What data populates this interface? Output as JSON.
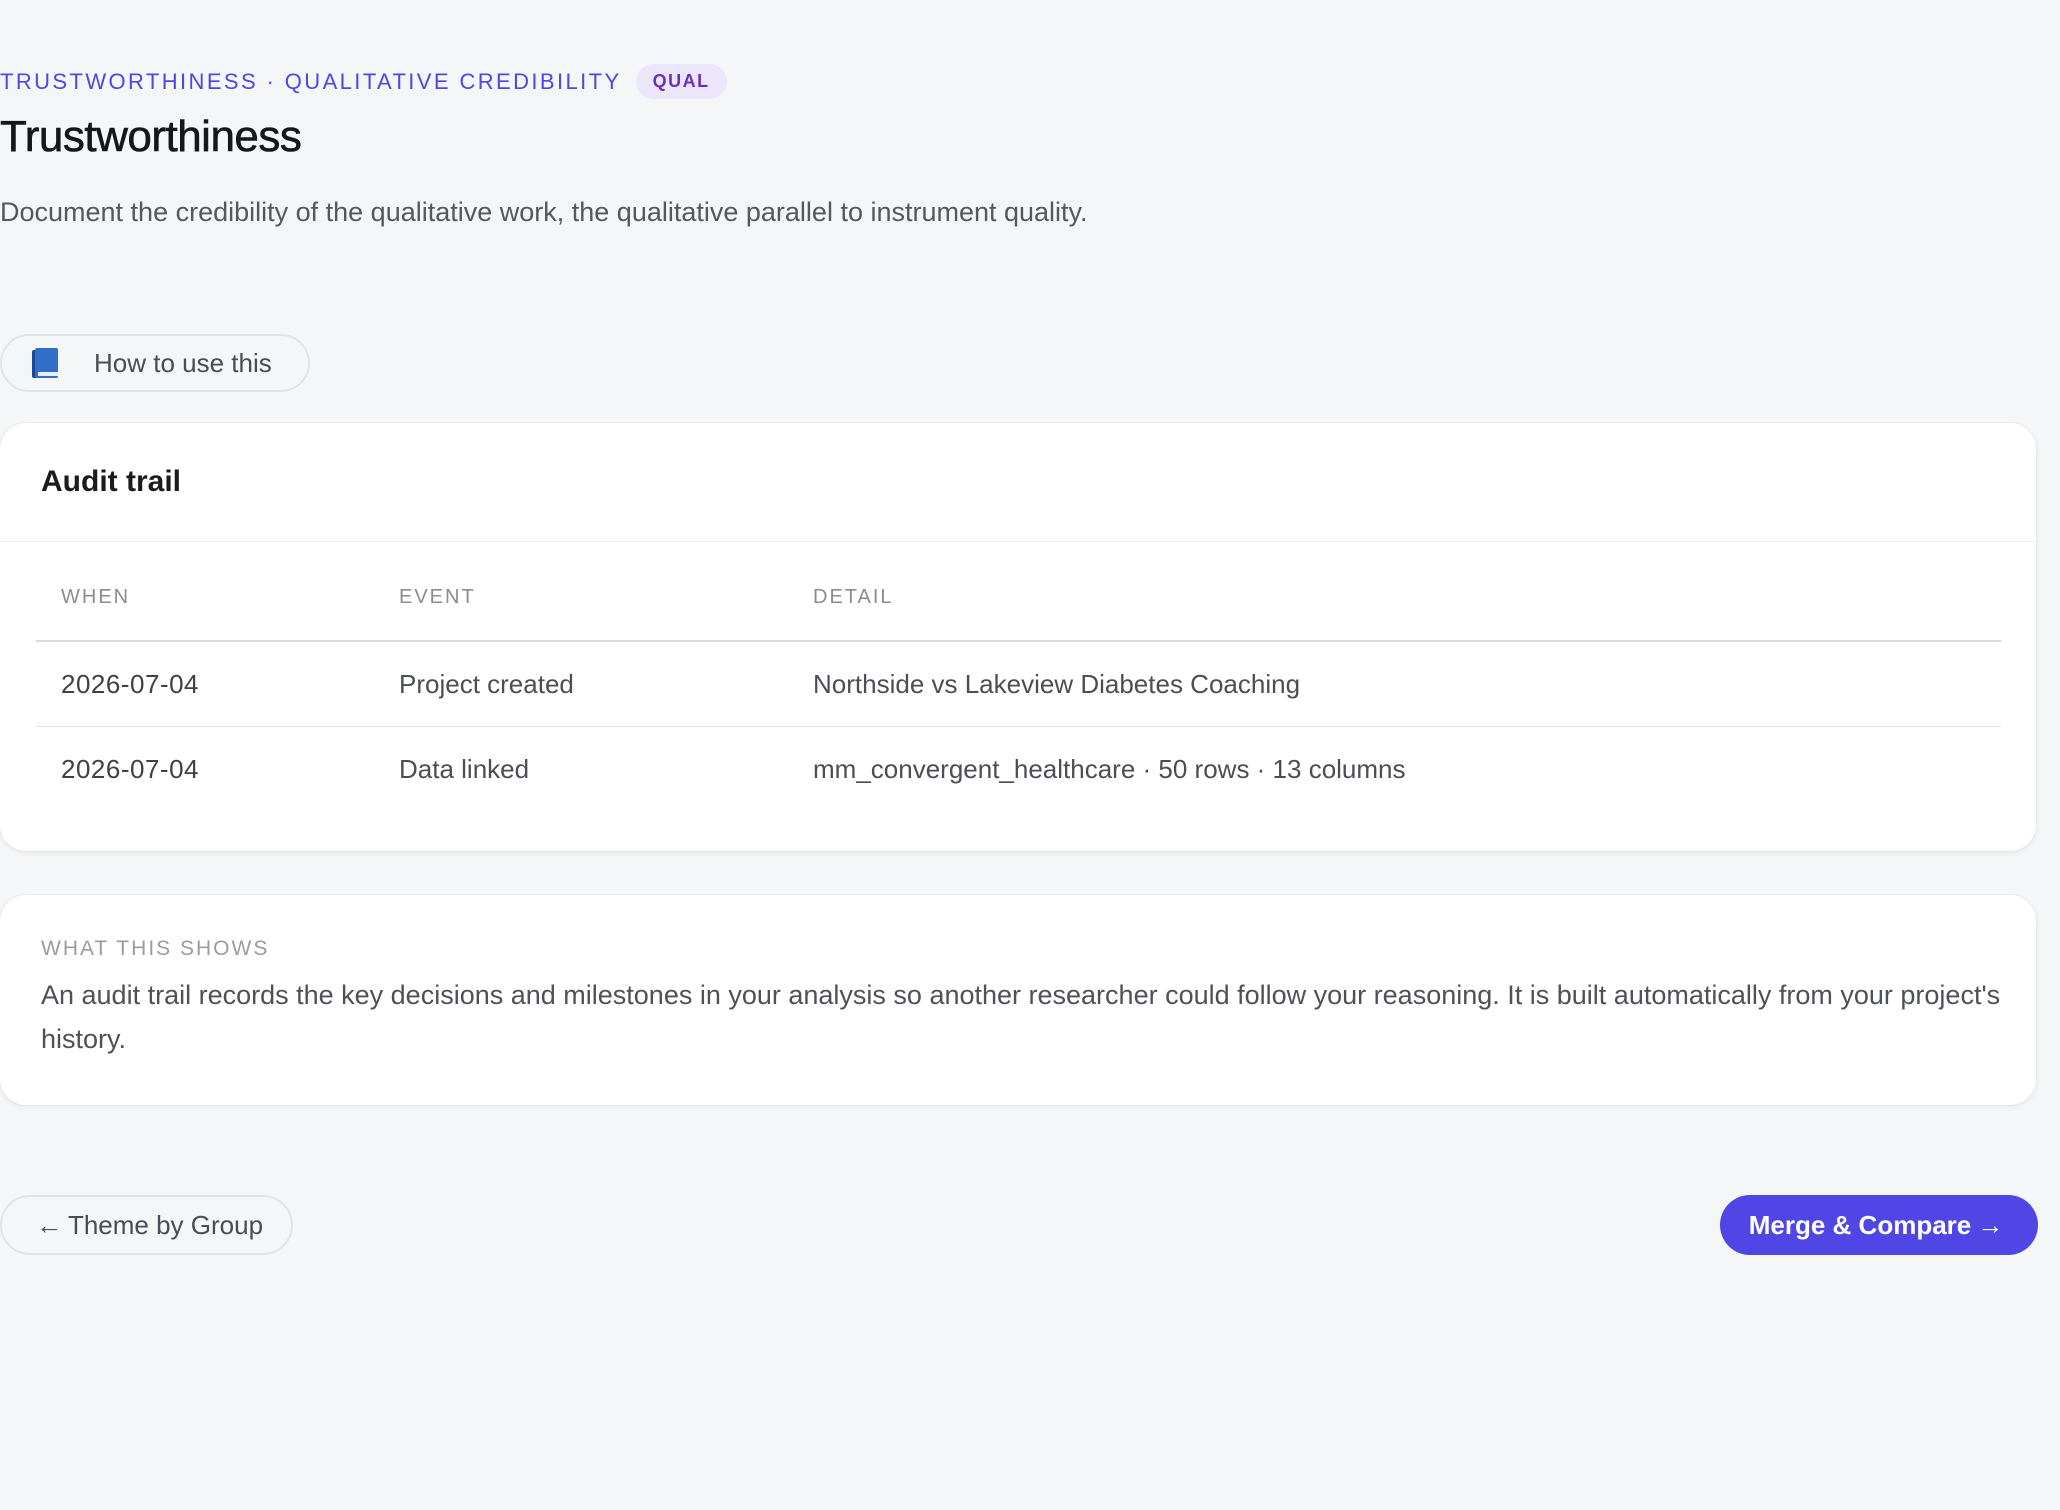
{
  "header": {
    "eyebrow": "TRUSTWORTHINESS · QUALITATIVE CREDIBILITY",
    "badge": "QUAL",
    "title": "Trustworthiness",
    "subtitle": "Document the credibility of the qualitative work, the qualitative parallel to instrument quality."
  },
  "howto": {
    "icon": "book-icon",
    "label": "How to use this"
  },
  "audit": {
    "title": "Audit trail",
    "columns": [
      "WHEN",
      "EVENT",
      "DETAIL"
    ],
    "rows": [
      {
        "when": "2026-07-04",
        "event": "Project created",
        "detail": "Northside vs Lakeview Diabetes Coaching"
      },
      {
        "when": "2026-07-04",
        "event": "Data linked",
        "detail": "mm_convergent_healthcare · 50 rows · 13 columns"
      }
    ]
  },
  "info": {
    "heading": "WHAT THIS SHOWS",
    "text": "An audit trail records the key decisions and milestones in your analysis so another researcher could follow your reasoning. It is built automatically from your project's history."
  },
  "nav": {
    "prev_arrow": "←",
    "prev_label": "Theme by Group",
    "next_label": "Merge & Compare",
    "next_arrow": "→"
  },
  "colors": {
    "accent": "#4f46e5",
    "badge_bg": "#ece6fb",
    "badge_text": "#6b2fbf",
    "page_bg": "#f5f6f8"
  }
}
